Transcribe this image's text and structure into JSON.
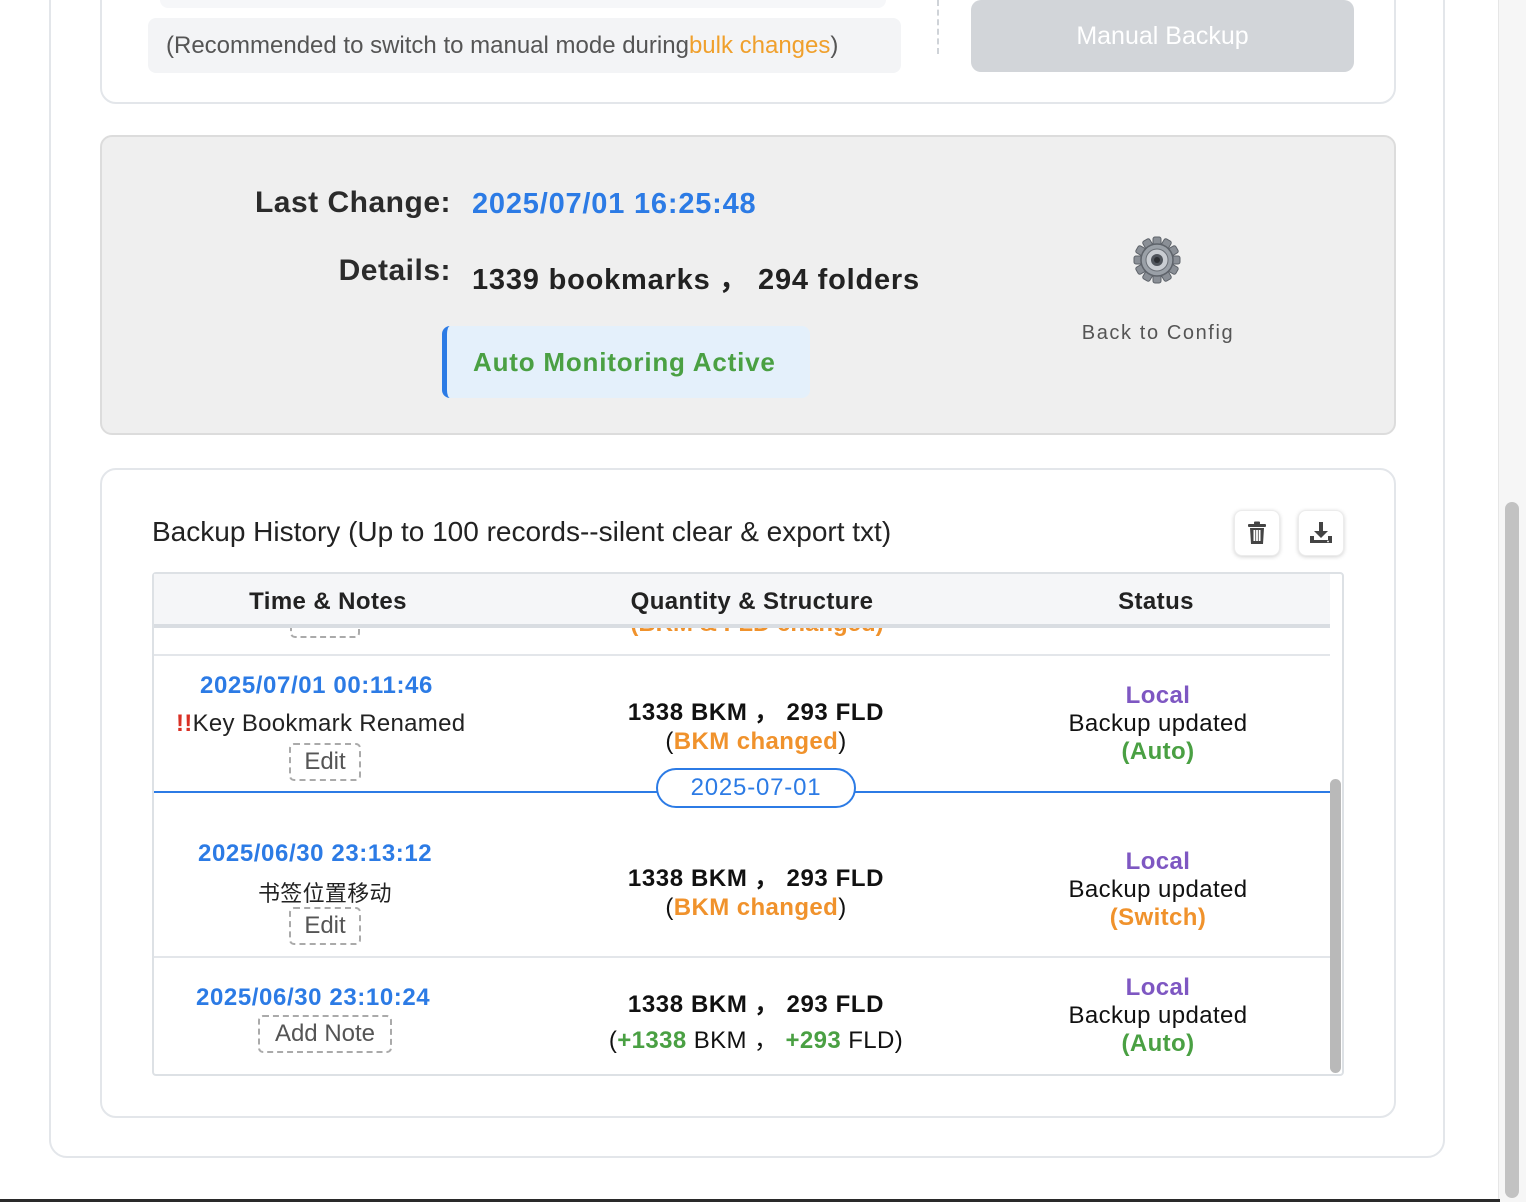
{
  "top": {
    "hint_prefix": "(Recommended to switch to manual mode during ",
    "hint_accent": "bulk changes",
    "hint_suffix": ")",
    "manual_backup_label": "Manual Backup"
  },
  "status": {
    "last_change_label": "Last Change:",
    "last_change_value": "2025/07/01 16:25:48",
    "details_label": "Details:",
    "details_value": "1339 bookmarks ， 294 folders",
    "monitor_badge": "Auto Monitoring Active",
    "config_label": "Back to Config",
    "config_icon": "gear-icon"
  },
  "history": {
    "title": "Backup History (Up to 100 records--silent clear & export txt)",
    "clear_icon": "trash-icon",
    "export_icon": "download-icon",
    "columns": [
      "Time & Notes",
      "Quantity & Structure",
      "Status"
    ],
    "partial_row": {
      "edit_label": "Edit",
      "change_label": "(BKM & FLD changed)"
    },
    "rows": [
      {
        "time": "2025/07/01 00:11:46",
        "warn_mark": "!!",
        "note": "Key Bookmark Renamed",
        "edit_label": "Edit",
        "qty": "1338 BKM ， 293 FLD",
        "change_open": "(",
        "change": "BKM changed",
        "change_close": ")",
        "location": "Local",
        "status": "Backup updated",
        "mode": "(Auto)"
      },
      {
        "time": "2025/06/30 23:13:12",
        "note": "书签位置移动",
        "edit_label": "Edit",
        "qty": "1338 BKM ， 293 FLD",
        "change_open": "(",
        "change": "BKM changed",
        "change_close": ")",
        "location": "Local",
        "status": "Backup updated",
        "mode": "(Switch)"
      },
      {
        "time": "2025/06/30 23:10:24",
        "edit_label": "Add Note",
        "qty": "1338 BKM ， 293 FLD",
        "diff_open": "(",
        "diff_bkm": "+1338",
        "diff_bkm_unit": " BKM ， ",
        "diff_fld": "+293",
        "diff_fld_unit": " FLD)",
        "location": "Local",
        "status": "Backup updated",
        "mode": "(Auto)"
      }
    ],
    "date_divider": "2025-07-01"
  },
  "colors": {
    "accent_blue": "#2c7be5",
    "orange": "#f0922c",
    "green": "#4aa043",
    "purple": "#7e57c2"
  }
}
